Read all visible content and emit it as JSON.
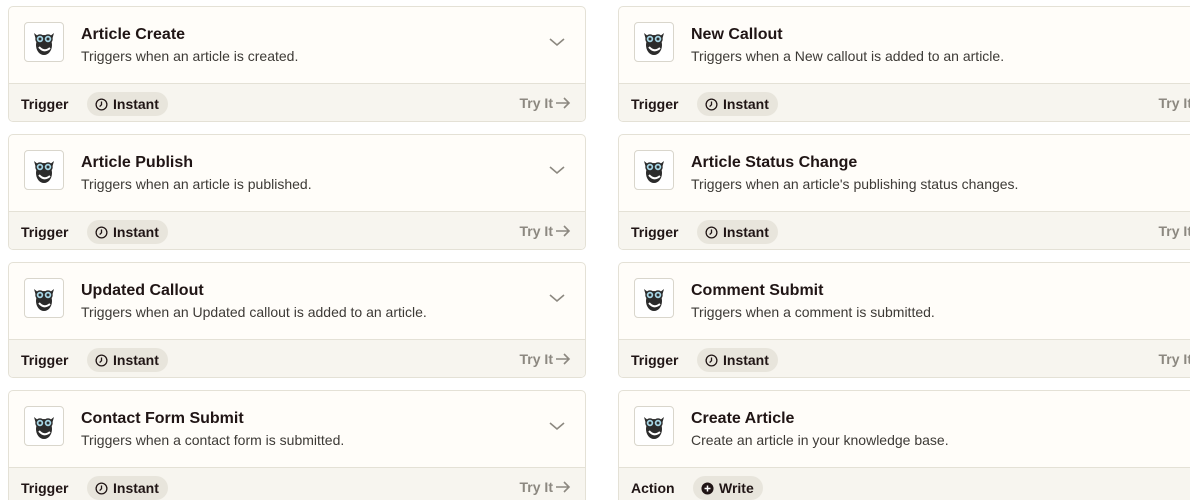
{
  "colors": {
    "card_background": "#fffdf9",
    "footer_background": "#f7f5ef",
    "pill_background": "#e8e5dc",
    "border": "#e4e1d6",
    "text_primary": "#201515",
    "text_muted": "#8c8880"
  },
  "icons": {
    "app_logo": "owl-logo-icon",
    "expand": "chevron-down-icon",
    "instant": "clock-icon",
    "write": "plus-circle-icon",
    "try_it": "arrow-right-icon"
  },
  "cards": [
    {
      "title": "Article Create",
      "description": "Triggers when an article is created.",
      "kind": "Trigger",
      "badge": "Instant",
      "try_label": "Try It"
    },
    {
      "title": "New Callout",
      "description": "Triggers when a New callout is added to an article.",
      "kind": "Trigger",
      "badge": "Instant",
      "try_label": "Try It"
    },
    {
      "title": "Article Publish",
      "description": "Triggers when an article is published.",
      "kind": "Trigger",
      "badge": "Instant",
      "try_label": "Try It"
    },
    {
      "title": "Article Status Change",
      "description": "Triggers when an article's publishing status changes.",
      "kind": "Trigger",
      "badge": "Instant",
      "try_label": "Try It"
    },
    {
      "title": "Updated Callout",
      "description": "Triggers when an Updated callout is added to an article.",
      "kind": "Trigger",
      "badge": "Instant",
      "try_label": "Try It"
    },
    {
      "title": "Comment Submit",
      "description": "Triggers when a comment is submitted.",
      "kind": "Trigger",
      "badge": "Instant",
      "try_label": "Try It"
    },
    {
      "title": "Contact Form Submit",
      "description": "Triggers when a contact form is submitted.",
      "kind": "Trigger",
      "badge": "Instant",
      "try_label": "Try It"
    },
    {
      "title": "Create Article",
      "description": "Create an article in your knowledge base.",
      "kind": "Action",
      "badge": "Write"
    }
  ]
}
